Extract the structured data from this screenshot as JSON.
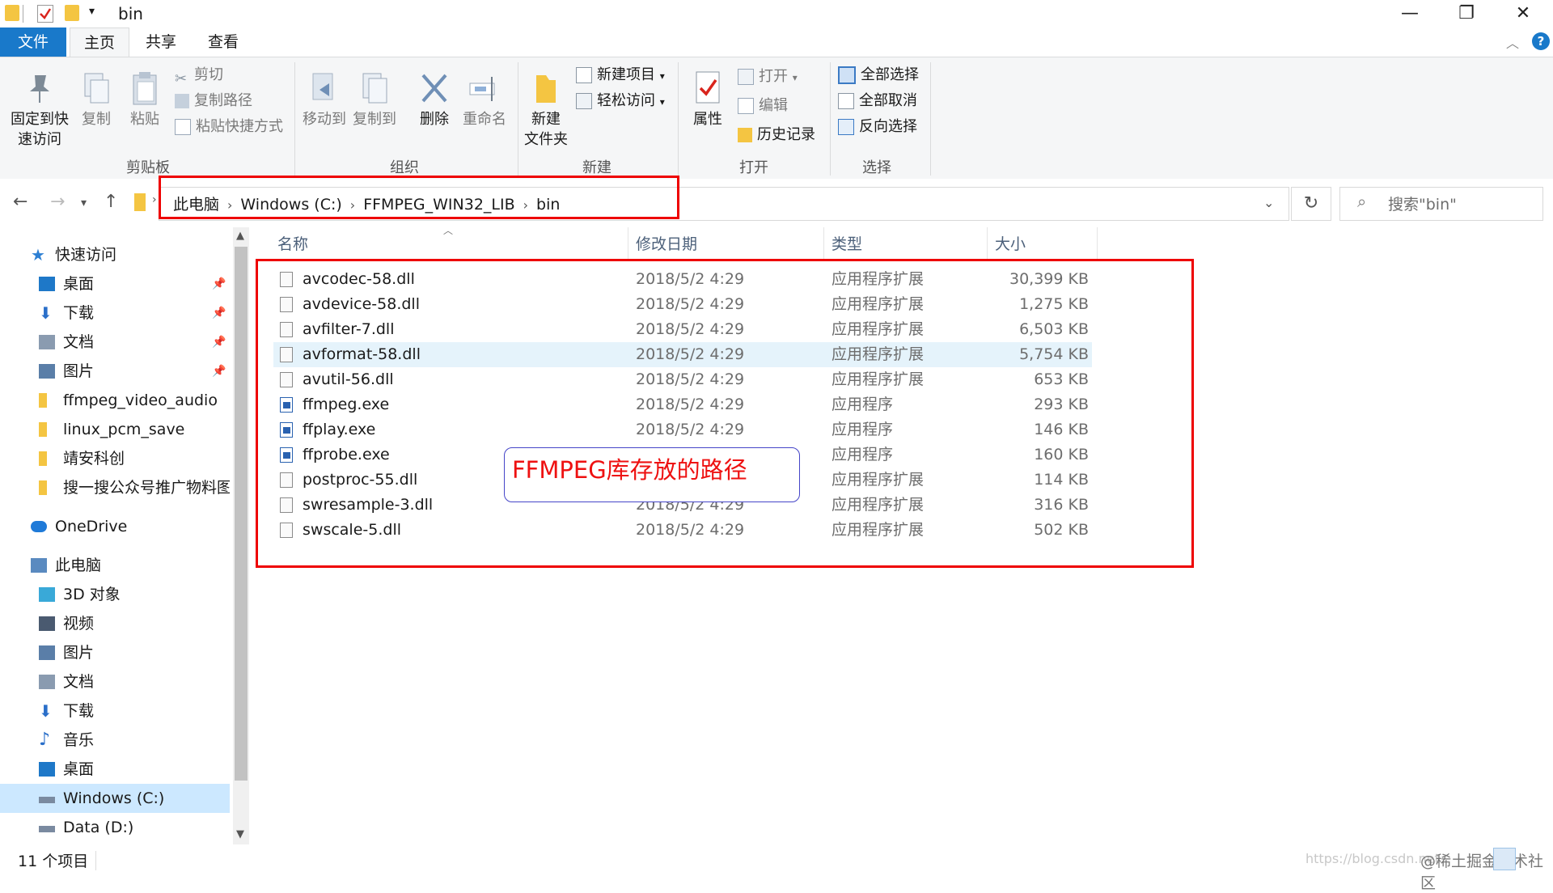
{
  "window": {
    "title": "bin",
    "minimize": "—",
    "maximize": "❐",
    "close": "✕"
  },
  "ribbon_tabs": [
    "文件",
    "主页",
    "共享",
    "查看"
  ],
  "ribbon": {
    "clipboard": {
      "pin_label": [
        "固定到快",
        "速访问"
      ],
      "copy": "复制",
      "paste": "粘贴",
      "cut": "剪切",
      "copy_path": "复制路径",
      "paste_shortcut": "粘贴快捷方式",
      "group": "剪贴板"
    },
    "organize": {
      "move_to": "移动到",
      "copy_to": "复制到",
      "delete": "删除",
      "rename": "重命名",
      "group": "组织"
    },
    "new": {
      "new_folder": [
        "新建",
        "文件夹"
      ],
      "new_item": "新建项目",
      "easy_access": "轻松访问",
      "group": "新建"
    },
    "open": {
      "properties": "属性",
      "open": "打开",
      "edit": "编辑",
      "history": "历史记录",
      "group": "打开"
    },
    "select": {
      "select_all": "全部选择",
      "select_none": "全部取消",
      "invert": "反向选择",
      "group": "选择"
    }
  },
  "address": {
    "crumbs": [
      "此电脑",
      "Windows (C:)",
      "FFMPEG_WIN32_LIB",
      "bin"
    ],
    "search_placeholder": "搜索\"bin\""
  },
  "columns": {
    "name": "名称",
    "date": "修改日期",
    "type": "类型",
    "size": "大小"
  },
  "files": [
    {
      "name": "avcodec-58.dll",
      "date": "2018/5/2 4:29",
      "type": "应用程序扩展",
      "size": "30,399 KB",
      "kind": "dll"
    },
    {
      "name": "avdevice-58.dll",
      "date": "2018/5/2 4:29",
      "type": "应用程序扩展",
      "size": "1,275 KB",
      "kind": "dll"
    },
    {
      "name": "avfilter-7.dll",
      "date": "2018/5/2 4:29",
      "type": "应用程序扩展",
      "size": "6,503 KB",
      "kind": "dll"
    },
    {
      "name": "avformat-58.dll",
      "date": "2018/5/2 4:29",
      "type": "应用程序扩展",
      "size": "5,754 KB",
      "kind": "dll",
      "selected": true
    },
    {
      "name": "avutil-56.dll",
      "date": "2018/5/2 4:29",
      "type": "应用程序扩展",
      "size": "653 KB",
      "kind": "dll"
    },
    {
      "name": "ffmpeg.exe",
      "date": "2018/5/2 4:29",
      "type": "应用程序",
      "size": "293 KB",
      "kind": "exe"
    },
    {
      "name": "ffplay.exe",
      "date": "2018/5/2 4:29",
      "type": "应用程序",
      "size": "146 KB",
      "kind": "exe"
    },
    {
      "name": "ffprobe.exe",
      "date": "2018/5/2 4:29",
      "type": "应用程序",
      "size": "160 KB",
      "kind": "exe"
    },
    {
      "name": "postproc-55.dll",
      "date": "2018/5/2 4:29",
      "type": "应用程序扩展",
      "size": "114 KB",
      "kind": "dll"
    },
    {
      "name": "swresample-3.dll",
      "date": "2018/5/2 4:29",
      "type": "应用程序扩展",
      "size": "316 KB",
      "kind": "dll"
    },
    {
      "name": "swscale-5.dll",
      "date": "2018/5/2 4:29",
      "type": "应用程序扩展",
      "size": "502 KB",
      "kind": "dll"
    }
  ],
  "sidebar": [
    {
      "label": "快速访问",
      "icon": "star-icon",
      "color": "#2d7fd3",
      "level": 0
    },
    {
      "label": "桌面",
      "icon": "desktop-icon",
      "color": "#1e78c8",
      "level": 1,
      "pinned": true
    },
    {
      "label": "下载",
      "icon": "download-icon",
      "color": "#2a6fc9",
      "level": 1,
      "pinned": true
    },
    {
      "label": "文档",
      "icon": "document-icon",
      "color": "#8a9bb0",
      "level": 1,
      "pinned": true
    },
    {
      "label": "图片",
      "icon": "pictures-icon",
      "color": "#5a7ea8",
      "level": 1,
      "pinned": true
    },
    {
      "label": "ffmpeg_video_audio",
      "icon": "folder-icon",
      "color": "#f4c542",
      "level": 1
    },
    {
      "label": "linux_pcm_save",
      "icon": "folder-icon",
      "color": "#f4c542",
      "level": 1
    },
    {
      "label": "靖安科创",
      "icon": "folder-icon",
      "color": "#f4c542",
      "level": 1
    },
    {
      "label": "搜一搜公众号推广物料图片",
      "icon": "folder-icon",
      "color": "#f4c542",
      "level": 1
    },
    {
      "label": "OneDrive",
      "icon": "cloud-icon",
      "color": "#1f7ad8",
      "level": 0,
      "gap": true
    },
    {
      "label": "此电脑",
      "icon": "computer-icon",
      "color": "#5a8ac0",
      "level": 0,
      "gap": true
    },
    {
      "label": "3D 对象",
      "icon": "cube-icon",
      "color": "#39a9d8",
      "level": 1
    },
    {
      "label": "视频",
      "icon": "video-icon",
      "color": "#4a5a70",
      "level": 1
    },
    {
      "label": "图片",
      "icon": "pictures-icon",
      "color": "#5a7ea8",
      "level": 1
    },
    {
      "label": "文档",
      "icon": "document-icon",
      "color": "#8a9bb0",
      "level": 1
    },
    {
      "label": "下载",
      "icon": "download-icon",
      "color": "#2a6fc9",
      "level": 1
    },
    {
      "label": "音乐",
      "icon": "music-icon",
      "color": "#2a6fc9",
      "level": 1
    },
    {
      "label": "桌面",
      "icon": "desktop-icon",
      "color": "#1e78c8",
      "level": 1
    },
    {
      "label": "Windows (C:)",
      "icon": "drive-icon",
      "color": "#7a8aa0",
      "level": 1,
      "selected": true
    },
    {
      "label": "Data (D:)",
      "icon": "drive-icon",
      "color": "#7a8aa0",
      "level": 1
    }
  ],
  "status": {
    "count": "11 个项目"
  },
  "annotation": {
    "text": "FFMPEG库存放的路径"
  },
  "watermark": {
    "left": "https://blog.csdn.net",
    "right": "@稀土掘金技术社区"
  }
}
